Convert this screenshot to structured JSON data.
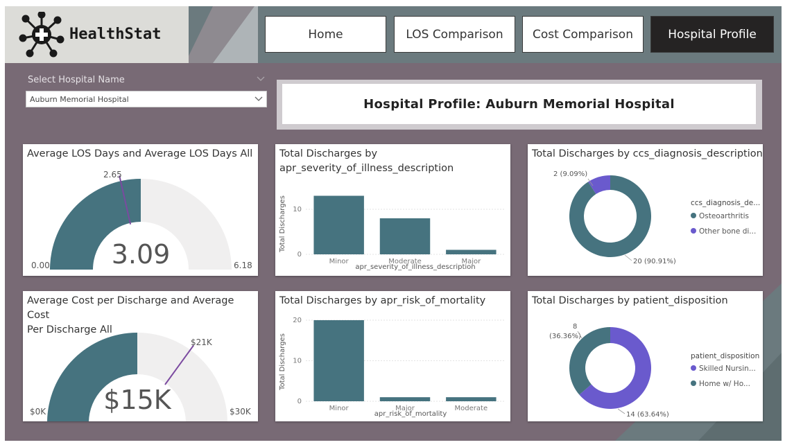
{
  "app": {
    "name": "HealthStat"
  },
  "nav": [
    {
      "label": "Home",
      "active": false
    },
    {
      "label": "LOS Comparison",
      "active": false
    },
    {
      "label": "Cost Comparison",
      "active": false
    },
    {
      "label": "Hospital Profile",
      "active": true
    }
  ],
  "slicer": {
    "label": "Select Hospital Name",
    "value": "Auburn Memorial Hospital"
  },
  "page_title": "Hospital Profile: Auburn Memorial Hospital",
  "colors": {
    "teal": "#46737f",
    "purple": "#6a5acd",
    "gauge_bg": "#f0efef",
    "frame": "#786a75",
    "header": "#6b7a7e"
  },
  "cards": {
    "los": {
      "title": "Average LOS Days and Average LOS Days All",
      "min_label": "0.00",
      "max_label": "6.18",
      "value_label": "3.09",
      "target_label": "2.65"
    },
    "cost": {
      "title_line1": "Average Cost per Discharge and Average Cost",
      "title_line2": "Per Discharge All",
      "min_label": "$0K",
      "max_label": "$30K",
      "value_label": "$15K",
      "target_label": "$21K"
    },
    "severity": {
      "title_line1": "Total Discharges by",
      "title_line2": "apr_severity_of_illness_description"
    },
    "mortality": {
      "title": "Total Discharges by apr_risk_of_mortality"
    },
    "diagnosis": {
      "title": "Total Discharges by ccs_diagnosis_description"
    },
    "disposition": {
      "title": "Total Discharges by patient_disposition"
    }
  },
  "chart_data": [
    {
      "type": "gauge",
      "title": "Average LOS Days and Average LOS Days All",
      "min": 0.0,
      "max": 6.18,
      "value": 3.09,
      "target": 2.65
    },
    {
      "type": "gauge",
      "title": "Average Cost per Discharge and Average Cost Per Discharge All",
      "min": 0,
      "max": 30,
      "value": 15,
      "target": 21,
      "unit": "$K"
    },
    {
      "type": "bar",
      "title": "Total Discharges by apr_severity_of_illness_description",
      "categories": [
        "Minor",
        "Moderate",
        "Major"
      ],
      "values": [
        13,
        8,
        1
      ],
      "xlabel": "apr_severity_of_illness_description",
      "ylabel": "Total Discharges",
      "ylim": [
        0,
        14
      ],
      "yticks": [
        0,
        10
      ],
      "grid": true
    },
    {
      "type": "bar",
      "title": "Total Discharges by apr_risk_of_mortality",
      "categories": [
        "Minor",
        "Major",
        "Moderate"
      ],
      "values": [
        20,
        1,
        1
      ],
      "xlabel": "apr_risk_of_mortality",
      "ylabel": "Total Discharges",
      "ylim": [
        0,
        20
      ],
      "yticks": [
        0,
        10,
        20
      ],
      "grid": true
    },
    {
      "type": "pie",
      "title": "Total Discharges by ccs_diagnosis_description",
      "legend_title": "ccs_diagnosis_de...",
      "legend_position": "right",
      "slices": [
        {
          "name": "Osteoarthritis",
          "legend_label": "Osteoarthritis",
          "value": 20,
          "label": "20 (90.91%)",
          "color": "#46737f"
        },
        {
          "name": "Other bone di...",
          "legend_label": "Other bone di...",
          "value": 2,
          "label": "2 (9.09%)",
          "color": "#6a5acd"
        }
      ]
    },
    {
      "type": "pie",
      "title": "Total Discharges by patient_disposition",
      "legend_title": "patient_disposition",
      "legend_position": "right",
      "slices": [
        {
          "name": "Skilled Nursin...",
          "legend_label": "Skilled Nursin...",
          "value": 14,
          "label": "14 (63.64%)",
          "color": "#6a5acd"
        },
        {
          "name": "Home w/ Ho...",
          "legend_label": "Home w/ Ho...",
          "value": 8,
          "label_line1": "8",
          "label_line2": "(36.36%)",
          "color": "#46737f"
        }
      ]
    }
  ]
}
